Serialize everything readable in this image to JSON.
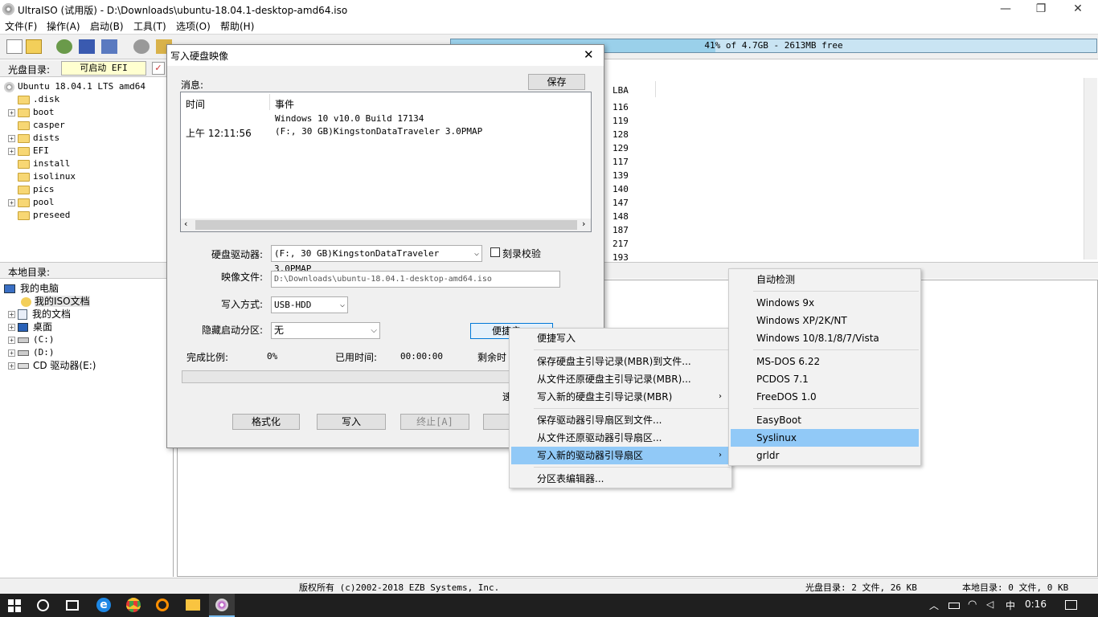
{
  "window": {
    "title": "UltraISO (试用版) - D:\\Downloads\\ubuntu-18.04.1-desktop-amd64.iso",
    "controls": [
      "—",
      "❐",
      "✕"
    ]
  },
  "menubar": [
    "文件(F)",
    "操作(A)",
    "启动(B)",
    "工具(T)",
    "选项(O)",
    "帮助(H)"
  ],
  "toolbar": {
    "free_text": "41% of 4.7GB - 2613MB free",
    "used_fraction": 0.41
  },
  "disc": {
    "header_label": "光盘目录:",
    "boot_label": "可启动 EFI",
    "root": "Ubuntu 18.04.1 LTS amd64",
    "folders": [
      ".disk",
      "boot",
      "casper",
      "dists",
      "EFI",
      "install",
      "isolinux",
      "pics",
      "pool",
      "preseed"
    ]
  },
  "local": {
    "header_label": "本地目录:",
    "items": [
      "我的电脑",
      "我的ISO文档",
      "我的文档",
      "桌面",
      "(C:)",
      "(D:)",
      "CD 驱动器(E:)"
    ]
  },
  "right_list": {
    "column": "LBA",
    "values": [
      "116",
      "119",
      "128",
      "129",
      "117",
      "139",
      "140",
      "147",
      "148",
      "187",
      "217",
      "193"
    ]
  },
  "status": {
    "copyright": "版权所有 (c)2002-2018 EZB Systems, Inc.",
    "disc_info": "光盘目录: 2 文件, 26 KB",
    "local_info": "本地目录: 0 文件, 0 KB"
  },
  "dialog": {
    "title": "写入硬盘映像",
    "close": "✕",
    "messages_label": "消息:",
    "save_button": "保存",
    "log_headers": [
      "时间",
      "事件"
    ],
    "log_rows": [
      {
        "time": "",
        "event": "Windows 10 v10.0 Build 17134"
      },
      {
        "time": "上午 12:11:56",
        "event": "(F:, 30 GB)KingstonDataTraveler 3.0PMAP"
      }
    ],
    "drive_label": "硬盘驱动器:",
    "drive_value": "(F:, 30 GB)KingstonDataTraveler 3.0PMAP",
    "verify_label": "刻录校验",
    "image_label": "映像文件:",
    "image_value": "D:\\Downloads\\ubuntu-18.04.1-desktop-amd64.iso",
    "write_mode_label": "写入方式:",
    "write_mode_value": "USB-HDD",
    "hidden_part_label": "隐藏启动分区:",
    "hidden_part_value": "无",
    "quick_button": "便捷启",
    "complete_label": "完成比例:",
    "complete_value": "0%",
    "elapsed_label": "已用时间:",
    "elapsed_value": "00:00:00",
    "remain_label": "剩余时",
    "speed_label": "速",
    "progress_fraction": 0,
    "buttons": {
      "format": "格式化",
      "write": "写入",
      "stop": "终止[A]"
    }
  },
  "context_menu": {
    "items": [
      "便捷写入",
      "保存硬盘主引导记录(MBR)到文件...",
      "从文件还原硬盘主引导记录(MBR)...",
      "写入新的硬盘主引导记录(MBR)",
      "保存驱动器引导扇区到文件...",
      "从文件还原驱动器引导扇区...",
      "写入新的驱动器引导扇区",
      "分区表编辑器..."
    ],
    "submenu_arrow": "›"
  },
  "submenu": {
    "items": [
      "自动检测",
      "Windows 9x",
      "Windows XP/2K/NT",
      "Windows 10/8.1/8/7/Vista",
      "MS-DOS 6.22",
      "PCDOS 7.1",
      "FreeDOS 1.0",
      "EasyBoot",
      "Syslinux",
      "grldr"
    ],
    "highlighted": "Syslinux"
  },
  "taskbar": {
    "ime": "中",
    "time": "0:16"
  },
  "colors": {
    "highlight": "#91c9f7",
    "taskbar": "#1f1f1f",
    "freebar": "#9ad0ea"
  }
}
